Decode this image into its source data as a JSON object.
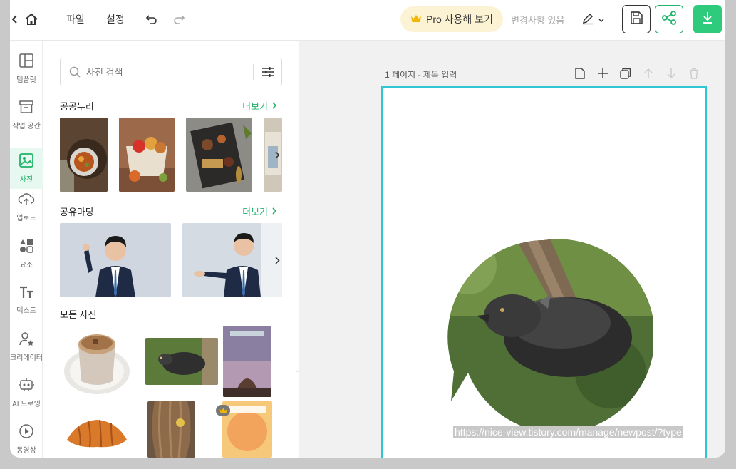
{
  "topbar": {
    "file_label": "파일",
    "settings_label": "설정",
    "pro_label": "Pro 사용해 보기",
    "changes_label": "변경사항 있음"
  },
  "rail": [
    {
      "label": "템플릿",
      "icon": "template-icon"
    },
    {
      "label": "작업 공간",
      "icon": "archive-icon"
    },
    {
      "label": "사진",
      "icon": "image-icon"
    },
    {
      "label": "업로드",
      "icon": "upload-cloud-icon"
    },
    {
      "label": "요소",
      "icon": "shapes-icon"
    },
    {
      "label": "텍스트",
      "icon": "text-icon"
    },
    {
      "label": "크리에이터",
      "icon": "creator-icon"
    },
    {
      "label": "AI 드로잉",
      "icon": "ai-drawing-icon"
    },
    {
      "label": "동영상",
      "icon": "play-icon"
    }
  ],
  "panel": {
    "search_placeholder": "사진 검색",
    "section1_title": "공공누리",
    "section2_title": "공유마당",
    "section3_title": "모든 사진",
    "more_label": "더보기"
  },
  "canvas": {
    "page_label": "1 페이지 - 제목 입력",
    "selected_text": "https://nice-view.tistory.com/manage/newpost/?type"
  },
  "colors": {
    "accent": "#1fb36a",
    "selection": "#2fc7d3",
    "pro_bg": "#fbf3d3"
  }
}
